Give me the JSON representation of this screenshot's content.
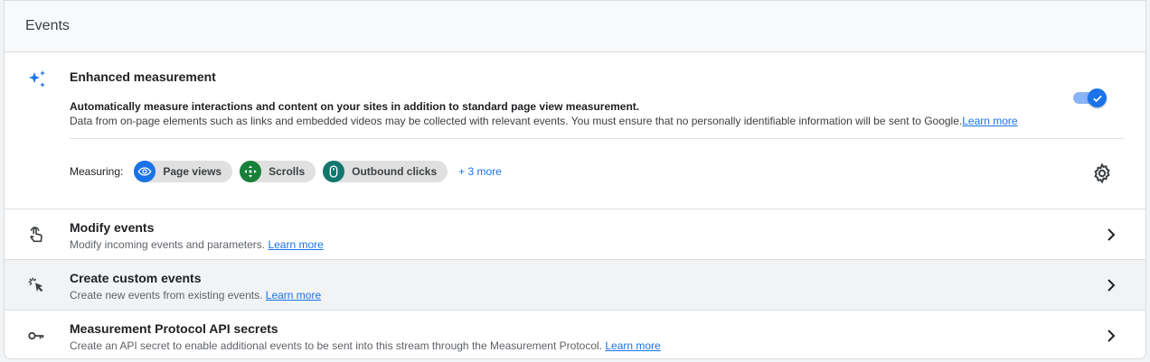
{
  "header": {
    "title": "Events"
  },
  "enhanced": {
    "title": "Enhanced measurement",
    "desc_bold": "Automatically measure interactions and content on your sites in addition to standard page view measurement.",
    "desc_regular": "Data from on-page elements such as links and embedded videos may be collected with relevant events. You must ensure that no personally identifiable information will be sent to Google.",
    "learn_more": "Learn more",
    "toggle_on": true,
    "measuring_label": "Measuring:",
    "chips": [
      {
        "label": "Page views",
        "icon": "eye-icon",
        "color": "#1a73e8"
      },
      {
        "label": "Scrolls",
        "icon": "scroll-arrows-icon",
        "color": "#188038"
      },
      {
        "label": "Outbound clicks",
        "icon": "mouse-icon",
        "color": "#12776e"
      }
    ],
    "more_label": "+ 3 more"
  },
  "rows": [
    {
      "title": "Modify events",
      "subtitle": "Modify incoming events and parameters.",
      "link": "Learn more",
      "icon": "touch-icon"
    },
    {
      "title": "Create custom events",
      "subtitle": "Create new events from existing events.",
      "link": "Learn more",
      "icon": "click-cursor-icon"
    },
    {
      "title": "Measurement Protocol API secrets",
      "subtitle": "Create an API secret to enable additional events to be sent into this stream through the Measurement Protocol.",
      "link": "Learn more",
      "icon": "key-icon"
    }
  ],
  "colors": {
    "accent": "#1a73e8",
    "toggle_track": "#8ab4f8"
  }
}
